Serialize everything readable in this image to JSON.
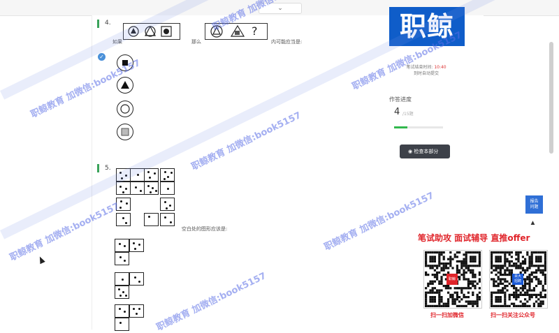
{
  "topbar": {
    "collapse_icon": "chevron-down"
  },
  "question4": {
    "number": "4.",
    "prompt_left": "如果",
    "prompt_mid": "那么",
    "prompt_right": "内可能应当是:",
    "question_mark": "?",
    "selected": "A"
  },
  "question5": {
    "number": "5.",
    "prompt": "空白处的图形应该是:"
  },
  "sidebar": {
    "brand": "职鲸",
    "timer_label": "笔试结束时间:",
    "timer_value": "10:40",
    "timer_note": "到时自动提交",
    "progress_title": "作答进度",
    "progress_value": "4",
    "progress_total": "/15题",
    "progress_fraction": 0.27,
    "check_button": "检查本部分",
    "report_button_line1": "报告",
    "report_button_line2": "问题"
  },
  "promo": {
    "title": "笔试助攻  面试辅导  直推offer",
    "qr1_caption": "扫一扫加微信",
    "qr2_caption": "扫一扫关注公众号",
    "qr1_badge": "职鲸",
    "qr2_badge_line1": "百大",
    "qr2_badge_line2": "招聘"
  },
  "watermark": {
    "text": "职鲸教育 加微信:book5157"
  },
  "colors": {
    "brand_blue": "#0f5dc9",
    "accent_red": "#e0242a",
    "progress_green": "#32b84d",
    "watermark": "#5a6ee6"
  }
}
